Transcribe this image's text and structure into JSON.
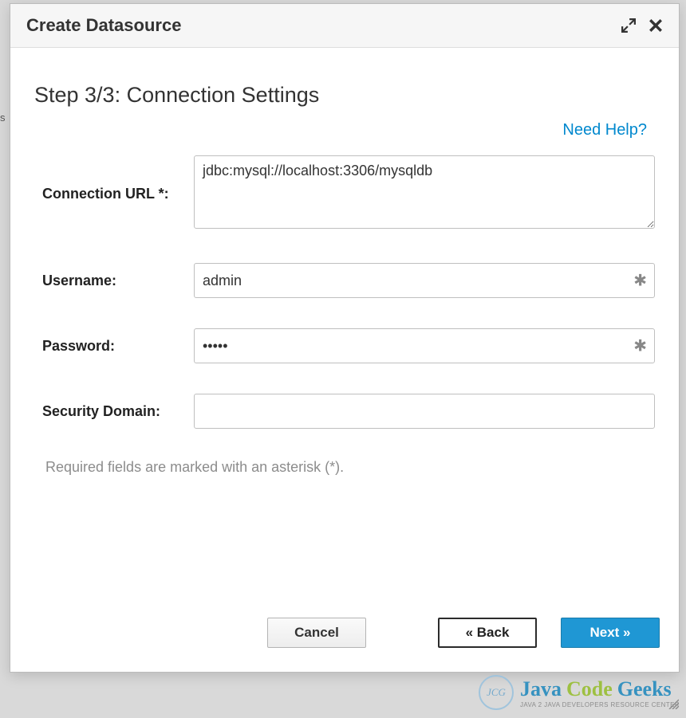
{
  "modal": {
    "title": "Create Datasource",
    "step_heading": "Step 3/3: Connection Settings",
    "help_link": "Need Help?",
    "required_note": "Required fields are marked with an asterisk (*)."
  },
  "form": {
    "connection_url": {
      "label": "Connection URL *:",
      "value": "jdbc:mysql://localhost:3306/mysqldb"
    },
    "username": {
      "label": "Username:",
      "value": "admin"
    },
    "password": {
      "label": "Password:",
      "value": "•••••"
    },
    "security_domain": {
      "label": "Security Domain:",
      "value": ""
    }
  },
  "buttons": {
    "cancel": "Cancel",
    "back": "« Back",
    "next": "Next »"
  },
  "watermark": {
    "logo_text": "JCG",
    "w1": "Java",
    "w2": "Code",
    "w3": "Geeks",
    "sub": "JAVA 2 JAVA DEVELOPERS RESOURCE CENTER"
  }
}
